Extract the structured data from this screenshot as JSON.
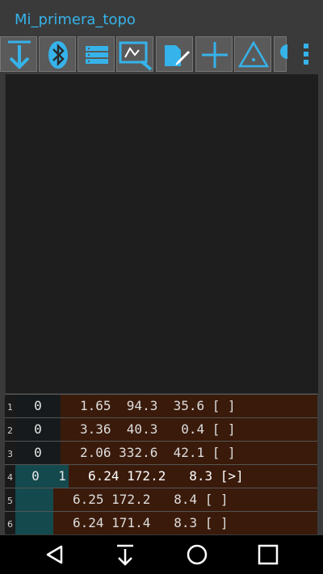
{
  "app": {
    "title": "Mi_primera_topo"
  },
  "toolbar": {
    "buttons": [
      {
        "name": "download-button",
        "icon": "download-arrow-icon"
      },
      {
        "name": "bluetooth-button",
        "icon": "bluetooth-icon"
      },
      {
        "name": "list-button",
        "icon": "list-icon"
      },
      {
        "name": "search-sketch-button",
        "icon": "search-sketch-icon"
      },
      {
        "name": "edit-note-button",
        "icon": "edit-note-icon"
      },
      {
        "name": "add-button",
        "icon": "plus-icon"
      },
      {
        "name": "warning-button",
        "icon": "warning-triangle-icon"
      },
      {
        "name": "partial-button",
        "icon": "partial-icon"
      }
    ],
    "overflow_icon": "more-vert-icon"
  },
  "shots": {
    "rows": [
      {
        "num": "1",
        "from": "0",
        "to": "",
        "data": "1.65  94.3  35.6 [ ]"
      },
      {
        "num": "2",
        "from": "0",
        "to": "",
        "data": "3.36  40.3   0.4 [ ]"
      },
      {
        "num": "3",
        "from": "0",
        "to": "",
        "data": "2.06 332.6  42.1 [ ]"
      },
      {
        "num": "4",
        "from": "0",
        "to": "1",
        "data": "6.24 172.2   8.3 [>]"
      },
      {
        "num": "5",
        "from": "",
        "to": "",
        "data": "6.25 172.2   8.4 [ ]"
      },
      {
        "num": "6",
        "from": "",
        "to": "",
        "data": "6.24 171.4   8.3 [ ]"
      }
    ]
  },
  "navbar": {
    "buttons": [
      "back-icon",
      "down-arrow-icon",
      "home-circle-icon",
      "recents-square-icon"
    ]
  },
  "colors": {
    "accent": "#36b3ea",
    "row_bg": "#3a1a0a",
    "teal": "#14494d"
  }
}
